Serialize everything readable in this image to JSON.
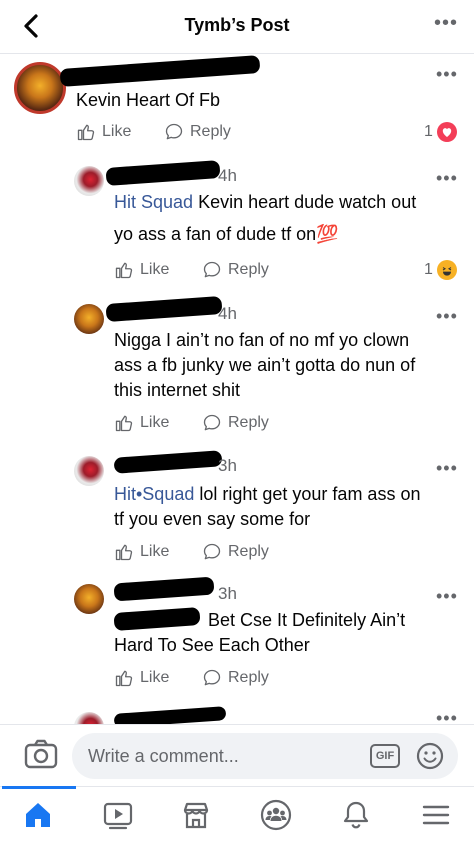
{
  "header": {
    "title": "Tymb’s Post",
    "more": "•••"
  },
  "comments": [
    {
      "id": 1,
      "time": "",
      "text": "Kevin Heart  Of Fb",
      "tag": "",
      "like": "Like",
      "reply": "Reply",
      "reaction_count": "1",
      "reaction": "love"
    },
    {
      "id": 2,
      "time": "4h",
      "tag": "Hit Squad",
      "text": " Kevin heart dude watch out",
      "text2": "yo ass a fan of dude tf on💯",
      "like": "Like",
      "reply": "Reply",
      "reaction_count": "1",
      "reaction": "haha"
    },
    {
      "id": 3,
      "time": "4h",
      "line1": "Nigga I ain’t no fan of no mf yo clown",
      "line2": "ass a fb junky we ain’t gotta do nun of",
      "line3": "this internet shit",
      "like": "Like",
      "reply": "Reply"
    },
    {
      "id": 4,
      "time": "3h",
      "tag": "Hit•Squad",
      "line1": " lol right get your fam ass on",
      "line2": "tf you even say some for",
      "like": "Like",
      "reply": "Reply"
    },
    {
      "id": 5,
      "time": "3h",
      "line1": "Bet Cse It Definitely Ain’t",
      "line2": "Hard To See Each Other",
      "like": "Like",
      "reply": "Reply"
    }
  ],
  "composer": {
    "placeholder": "Write a comment...",
    "gif": "GIF"
  },
  "colors": {
    "link": "#385898",
    "accent": "#1877f2",
    "love": "#f33e58",
    "haha": "#f7b125"
  },
  "icons": [
    "back-icon",
    "camera-icon",
    "gif-icon",
    "emoji-icon",
    "home-icon",
    "video-icon",
    "marketplace-icon",
    "groups-icon",
    "notifications-icon",
    "menu-icon"
  ]
}
